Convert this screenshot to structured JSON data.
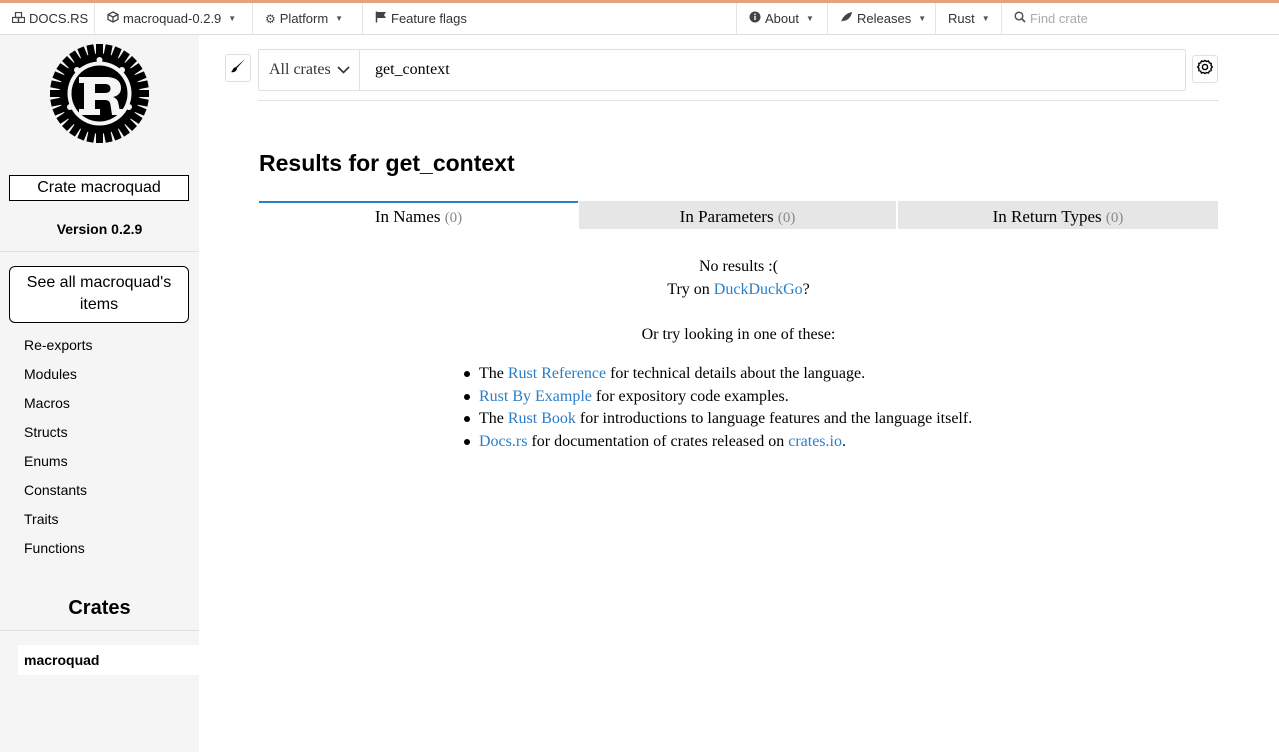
{
  "nav": {
    "docsrs": "DOCS.RS",
    "crate_version": "macroquad-0.2.9",
    "platform": "Platform",
    "feature_flags": "Feature flags",
    "about": "About",
    "releases": "Releases",
    "rust": "Rust",
    "find_placeholder": "Find crate"
  },
  "sidebar": {
    "crate_title": "Crate macroquad",
    "version": "Version 0.2.9",
    "all_items": "See all macroquad's items",
    "links": [
      "Re-exports",
      "Modules",
      "Macros",
      "Structs",
      "Enums",
      "Constants",
      "Traits",
      "Functions"
    ],
    "crates_heading": "Crates",
    "crates": [
      "macroquad"
    ]
  },
  "search": {
    "crate_filter": "All crates",
    "query": "get_context"
  },
  "results": {
    "title": "Results for get_context",
    "tabs": [
      {
        "label": "In Names",
        "count": "(0)"
      },
      {
        "label": "In Parameters",
        "count": "(0)"
      },
      {
        "label": "In Return Types",
        "count": "(0)"
      }
    ],
    "no_results": "No results :(",
    "try_on_prefix": "Try on",
    "try_on_link": "DuckDuckGo",
    "try_on_suffix": "?",
    "or_try": "Or try looking in one of these:",
    "suggestions": [
      {
        "pre": "The",
        "link": "Rust Reference",
        "post": "for technical details about the language."
      },
      {
        "pre": "",
        "link": "Rust By Example",
        "post": "for expository code examples."
      },
      {
        "pre": "The",
        "link": "Rust Book",
        "post": "for introductions to language features and the language itself."
      },
      {
        "pre": "",
        "link": "Docs.rs",
        "post": "for documentation of crates released on",
        "link2": "crates.io",
        "post2": "."
      }
    ]
  },
  "colors": {
    "link": "#2a7ec6",
    "sidebar_bg": "#f5f5f5",
    "accent_top": "#e1a47e"
  }
}
